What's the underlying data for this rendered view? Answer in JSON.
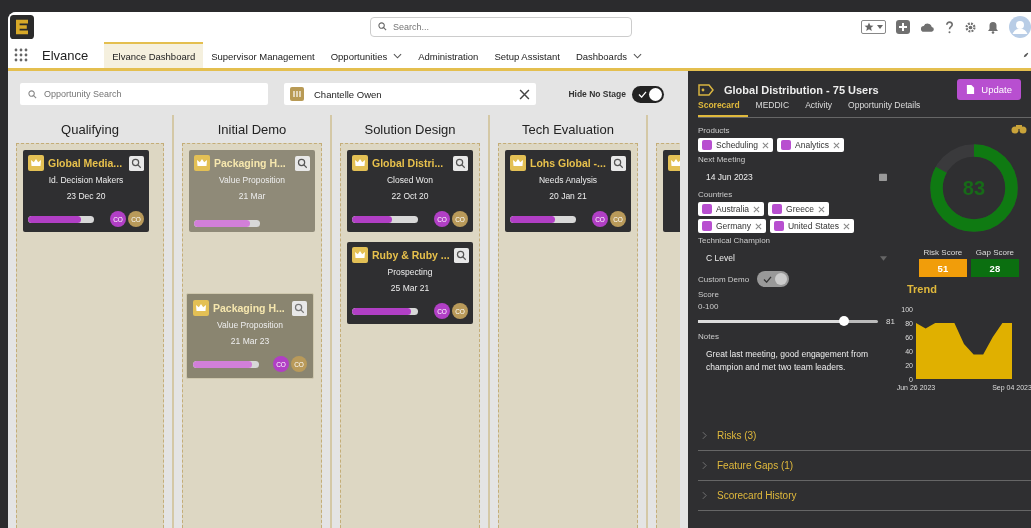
{
  "header": {
    "search": {
      "placeholder": "Search..."
    }
  },
  "nav": {
    "app_name": "Elvance",
    "tabs": [
      {
        "label": "Elvance Dashboard",
        "selected": true,
        "dropdown": false
      },
      {
        "label": "Supervisor Management",
        "selected": false,
        "dropdown": false
      },
      {
        "label": "Opportunities",
        "selected": false,
        "dropdown": true
      },
      {
        "label": "Administration",
        "selected": false,
        "dropdown": false
      },
      {
        "label": "Setup Assistant",
        "selected": false,
        "dropdown": false
      },
      {
        "label": "Dashboards",
        "selected": false,
        "dropdown": true
      }
    ]
  },
  "board": {
    "search": {
      "placeholder": "Opportunity Search"
    },
    "user_filter": {
      "value": "Chantelle Owen"
    },
    "hide_no_stage": {
      "label": "Hide No Stage",
      "on": true
    },
    "columns": [
      {
        "title": "Qualifying",
        "cards": [
          {
            "title": "Global Media...",
            "stage": "Id. Decision Makers",
            "date": "23 Dec 20",
            "level": 0.8,
            "avatars": [
              "CO",
              "CO"
            ],
            "faded": false
          }
        ]
      },
      {
        "title": "Initial Demo",
        "cards": [
          {
            "title": "Packaging H...",
            "stage": "Value Proposition",
            "date": "21 Mar",
            "level": 0.85,
            "faded": true
          }
        ]
      },
      {
        "title": "Solution Design",
        "cards": [
          {
            "title": "Global Distri...",
            "stage": "Closed Won",
            "date": "22 Oct 20",
            "level": 0.6,
            "avatars": [
              "CO",
              "CO"
            ],
            "faded": false
          },
          {
            "title": "Ruby & Ruby ...",
            "stage": "Prospecting",
            "date": "25 Mar 21",
            "level": 0.9,
            "avatars": [
              "CO",
              "CO"
            ],
            "faded": false
          }
        ]
      },
      {
        "title": "Tech Evaluation",
        "cards": [
          {
            "title": "Lohs Global -...",
            "stage": "Needs Analysis",
            "date": "20 Jan 21",
            "level": 0.68,
            "avatars": [
              "CO",
              "CO"
            ],
            "faded": false
          }
        ]
      },
      {
        "cards": [
          {
            "faded": false
          }
        ]
      }
    ],
    "dragged_card": {
      "title": "Packaging H...",
      "stage": "Value Proposition",
      "date": "21 Mar 23",
      "level": 0.9,
      "avatars": [
        "CO",
        "CO"
      ]
    }
  },
  "panel": {
    "title": "Global Distribution - 75 Users",
    "update_button": "Update",
    "tabs": [
      {
        "label": "Scorecard",
        "selected": true
      },
      {
        "label": "MEDDIC",
        "selected": false
      },
      {
        "label": "Activity",
        "selected": false
      },
      {
        "label": "Opportunity Details",
        "selected": false
      }
    ],
    "products": {
      "label": "Products",
      "chips": [
        "Scheduling",
        "Analytics"
      ]
    },
    "next_meeting": {
      "label": "Next Meeting",
      "value": "14 Jun 2023"
    },
    "countries": {
      "label": "Countries",
      "chips": [
        "Australia",
        "Greece",
        "Germany",
        "United States"
      ]
    },
    "technical_champion": {
      "label": "Technical Champion",
      "value": "C Level"
    },
    "custom_demo": {
      "label": "Custom Demo",
      "on": true
    },
    "score": {
      "label": "Score",
      "range": "0-100",
      "level": 0.81,
      "reading": "81"
    },
    "notes": {
      "label": "Notes",
      "value": "Great last meeting, good engagement from champion and met two team leaders."
    },
    "gauge": {
      "level": 0.83,
      "reading": "83"
    },
    "risk_score": {
      "label": "Risk Score",
      "value": "51"
    },
    "gap_score": {
      "label": "Gap Score",
      "value": "28"
    },
    "trend": {
      "title": "Trend",
      "chart_data": {
        "type": "area",
        "categories": [
          "Jun 26 2023",
          null,
          null,
          null,
          null,
          null,
          null,
          null,
          null,
          null,
          "Sep 04 2023"
        ],
        "series": [
          {
            "color": "#e0b000",
            "values": [
              80,
              72,
              80,
              80,
              80,
              50,
              35,
              35,
              60,
              80,
              80
            ]
          }
        ],
        "ylim": [
          0,
          100
        ],
        "yticks": [
          0,
          20,
          40,
          60,
          80,
          100
        ]
      }
    },
    "sections": [
      {
        "label": "Risks (3)",
        "expanded": false
      },
      {
        "label": "Feature Gaps (1)",
        "expanded": false
      },
      {
        "label": "Scorecard History",
        "expanded": false
      }
    ]
  }
}
